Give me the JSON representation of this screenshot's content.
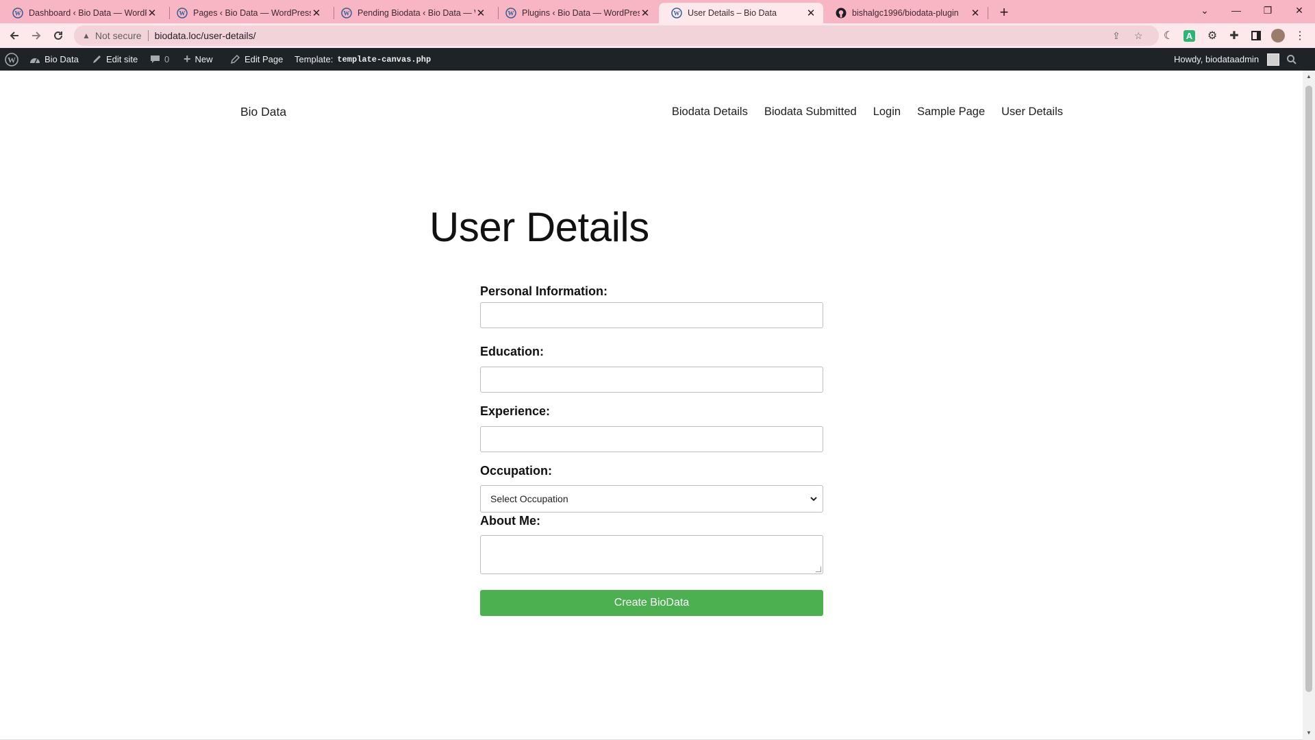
{
  "browser": {
    "tabs": [
      {
        "title": "Dashboard ‹ Bio Data — WordPress"
      },
      {
        "title": "Pages ‹ Bio Data — WordPress"
      },
      {
        "title": "Pending Biodata ‹ Bio Data — WordPress"
      },
      {
        "title": "Plugins ‹ Bio Data — WordPress"
      },
      {
        "title": "User Details – Bio Data",
        "active": true
      },
      {
        "title": "bishalgc1996/biodata-plugin"
      }
    ],
    "address": {
      "security": "Not secure",
      "url": "biodata.loc/user-details/"
    },
    "theme_color": "#f8b6c4"
  },
  "adminbar": {
    "site_name": "Bio Data",
    "edit_site": "Edit site",
    "comments_count": "0",
    "new_label": "New",
    "edit_page": "Edit Page",
    "template_label": "Template:",
    "template_file": "template-canvas.php",
    "howdy": "Howdy, biodataadmin"
  },
  "site": {
    "title": "Bio Data",
    "nav": [
      "Biodata Details",
      "Biodata Submitted",
      "Login",
      "Sample Page",
      "User Details"
    ]
  },
  "main": {
    "page_title": "User Details",
    "form": {
      "personal_label": "Personal Information:",
      "education_label": "Education:",
      "experience_label": "Experience:",
      "occupation_label": "Occupation:",
      "occupation_selected": "Select Occupation",
      "about_label": "About Me:",
      "submit_label": "Create BioData"
    }
  },
  "colors": {
    "submit": "#4caf50",
    "adminbar": "#1d2327"
  }
}
